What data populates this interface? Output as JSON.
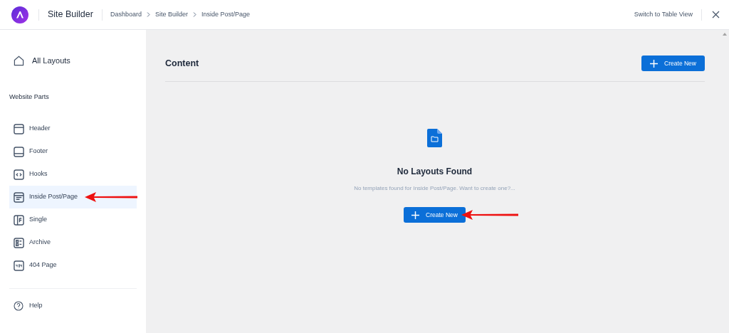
{
  "header": {
    "title": "Site Builder",
    "breadcrumbs": [
      "Dashboard",
      "Site Builder",
      "Inside Post/Page"
    ],
    "switch_view": "Switch to Table View"
  },
  "sidebar": {
    "all_layouts": "All Layouts",
    "section_title": "Website Parts",
    "items": [
      {
        "label": "Header",
        "kind": "header",
        "selected": false
      },
      {
        "label": "Footer",
        "kind": "footer",
        "selected": false
      },
      {
        "label": "Hooks",
        "kind": "hooks",
        "selected": false
      },
      {
        "label": "Inside Post/Page",
        "kind": "inside",
        "selected": true
      },
      {
        "label": "Single",
        "kind": "single",
        "selected": false
      },
      {
        "label": "Archive",
        "kind": "archive",
        "selected": false
      },
      {
        "label": "404 Page",
        "kind": "error",
        "selected": false
      }
    ],
    "help": "Help"
  },
  "content": {
    "title": "Content",
    "create_button": "Create New",
    "empty": {
      "title": "No Layouts Found",
      "message": "No templates found for Inside Post/Page. Want to create one?...",
      "button": "Create New"
    }
  }
}
